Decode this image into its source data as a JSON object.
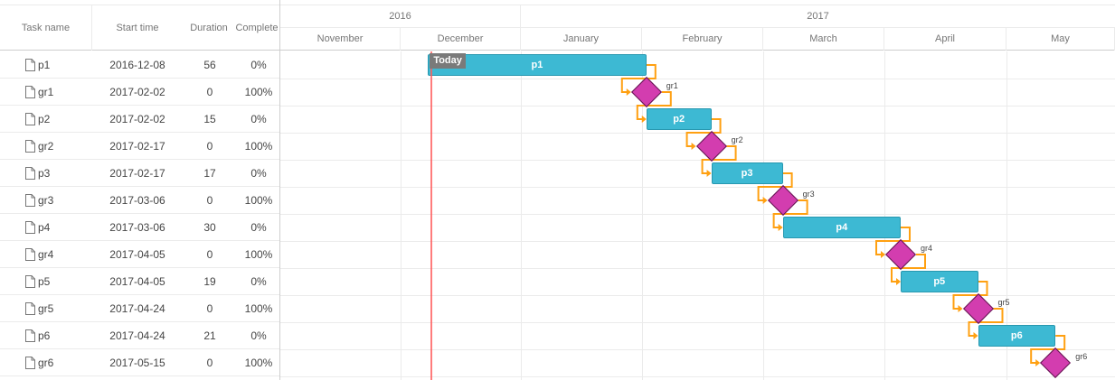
{
  "columns": {
    "task_name": "Task name",
    "start_time": "Start time",
    "duration": "Duration",
    "complete": "Complete"
  },
  "timescale": {
    "years": [
      "2016",
      "2017"
    ],
    "months": [
      "November",
      "December",
      "January",
      "February",
      "March",
      "April",
      "May"
    ]
  },
  "today_label": "Today",
  "today_date": "2016-12-09",
  "colors": {
    "task_bar": "#3db9d3",
    "milestone": "#d33daf",
    "link": "#ffa011",
    "today_line": "#ff5b5b"
  },
  "tasks": [
    {
      "name": "p1",
      "start": "2016-12-08",
      "duration": "56",
      "complete": "0%",
      "type": "task"
    },
    {
      "name": "gr1",
      "start": "2017-02-02",
      "duration": "0",
      "complete": "100%",
      "type": "milestone"
    },
    {
      "name": "p2",
      "start": "2017-02-02",
      "duration": "15",
      "complete": "0%",
      "type": "task"
    },
    {
      "name": "gr2",
      "start": "2017-02-17",
      "duration": "0",
      "complete": "100%",
      "type": "milestone"
    },
    {
      "name": "p3",
      "start": "2017-02-17",
      "duration": "17",
      "complete": "0%",
      "type": "task"
    },
    {
      "name": "gr3",
      "start": "2017-03-06",
      "duration": "0",
      "complete": "100%",
      "type": "milestone"
    },
    {
      "name": "p4",
      "start": "2017-03-06",
      "duration": "30",
      "complete": "0%",
      "type": "task"
    },
    {
      "name": "gr4",
      "start": "2017-04-05",
      "duration": "0",
      "complete": "100%",
      "type": "milestone"
    },
    {
      "name": "p5",
      "start": "2017-04-05",
      "duration": "19",
      "complete": "0%",
      "type": "task"
    },
    {
      "name": "gr5",
      "start": "2017-04-24",
      "duration": "0",
      "complete": "100%",
      "type": "milestone"
    },
    {
      "name": "p6",
      "start": "2017-04-24",
      "duration": "21",
      "complete": "0%",
      "type": "task"
    },
    {
      "name": "gr6",
      "start": "2017-05-15",
      "duration": "0",
      "complete": "100%",
      "type": "milestone"
    }
  ]
}
